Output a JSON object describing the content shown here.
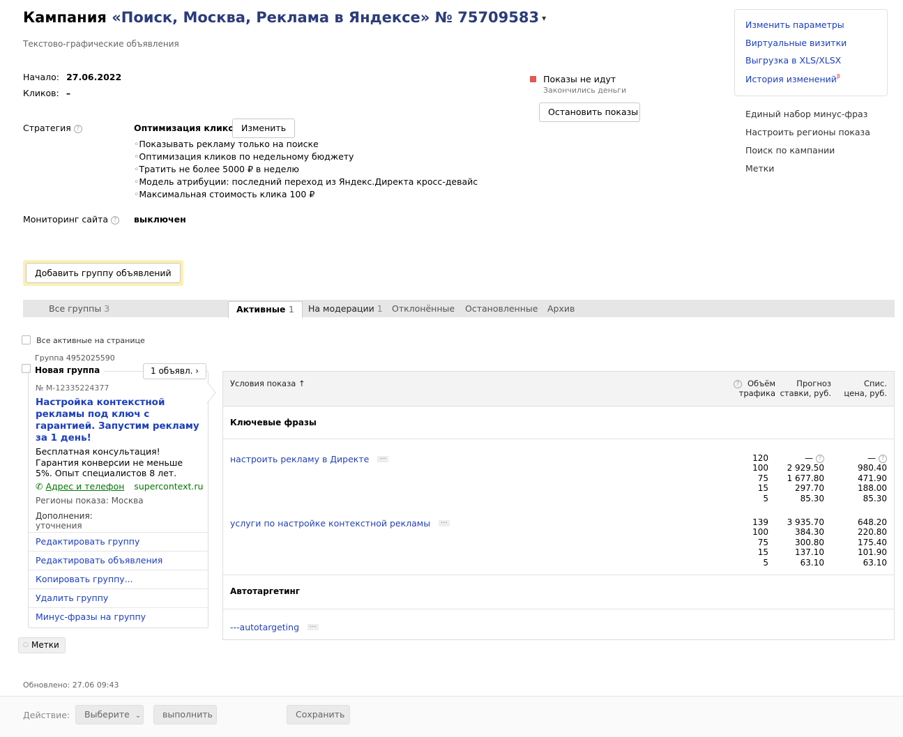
{
  "header": {
    "title_prefix": "Кампания",
    "campaign_name": "«Поиск, Москва, Реклама в Яндексе» № 75709583",
    "subtitle": "Текстово-графические объявления"
  },
  "meta": {
    "start_label": "Начало:",
    "start_value": "27.06.2022",
    "clicks_label": "Кликов:",
    "clicks_value": "–"
  },
  "status": {
    "title": "Показы не идут",
    "reason": "Закончились деньги",
    "stop_button": "Остановить показы",
    "color": "#e55656"
  },
  "strategy": {
    "label": "Стратегия",
    "name": "Оптимизация кликов",
    "change_button": "Изменить",
    "items": [
      "Показывать рекламу только на поиске",
      "Оптимизация кликов по недельному бюджету",
      "Тратить не более 5000 ₽ в неделю",
      "Модель атрибуции: последний переход из Яндекс.Директа кросс-девайс",
      "Максимальная стоимость клика 100 ₽"
    ]
  },
  "monitoring": {
    "label": "Мониторинг сайта",
    "value": "выключен"
  },
  "right_panel": {
    "box_links": [
      "Изменить параметры",
      "Виртуальные визитки",
      "Выгрузка в XLS/XLSX",
      "История изменений"
    ],
    "history_marker": "β",
    "links": [
      "Единый набор минус-фраз",
      "Настроить регионы показа",
      "Поиск по кампании",
      "Метки"
    ]
  },
  "add_group_button": "Добавить группу объявлений",
  "tabs": {
    "all_groups": {
      "label": "Все группы",
      "count": "3"
    },
    "active": {
      "label": "Активные",
      "count": "1"
    },
    "moderation": {
      "label": "На модерации",
      "count": "1"
    },
    "rejected": {
      "label": "Отклонённые"
    },
    "stopped": {
      "label": "Остановленные"
    },
    "archive": {
      "label": "Архив"
    }
  },
  "select_all_label": "Все активные на странице",
  "group": {
    "id_label": "Группа 4952025590",
    "name": "Новая группа",
    "ads_count_button": "1 объявл. ›",
    "ad": {
      "number": "№ М-12335224377",
      "title": "Настройка контекстной рекламы под ключ с гарантией. Запустим рекламу за 1 день!",
      "text": "Бесплатная консультация! Гарантия конверсии не меньше 5%. Опыт специалистов 8 лет.",
      "contact_link": "Адрес и телефон",
      "domain": "supercontext.ru",
      "regions": "Регионы показа: Москва",
      "extras_label": "Дополнения:",
      "extras_value": "уточнения"
    },
    "actions": [
      "Редактировать группу",
      "Редактировать объявления",
      "Копировать группу...",
      "Удалить группу",
      "Минус-фразы на группу"
    ]
  },
  "conditions": {
    "header": {
      "col1": "Условия показа ↑",
      "col2_line1": "Объём",
      "col2_line2": "трафика",
      "col3_line1": "Прогноз",
      "col3_line2": "ставки, руб.",
      "col4_line1": "Спис.",
      "col4_line2": "цена, руб."
    },
    "keywords_section": "Ключевые фразы",
    "keywords": [
      {
        "phrase": "настроить рекламу в Директе",
        "traffic": [
          "120",
          "100",
          "75",
          "15",
          "5"
        ],
        "bids": [
          "—",
          "2 929.50",
          "1 677.80",
          "297.70",
          "85.30"
        ],
        "prices": [
          "—",
          "980.40",
          "471.90",
          "188.00",
          "85.30"
        ]
      },
      {
        "phrase": "услуги по настройке контекстной рекламы",
        "traffic": [
          "139",
          "100",
          "75",
          "15",
          "5"
        ],
        "bids": [
          "3 935.70",
          "384.30",
          "300.80",
          "137.10",
          "63.10"
        ],
        "prices": [
          "648.20",
          "220.80",
          "175.40",
          "101.90",
          "63.10"
        ]
      }
    ],
    "autotargeting_section": "Автотаргетинг",
    "autotargeting_phrase": "---autotargeting",
    "dots": "···"
  },
  "tags_button": "Метки",
  "updated": "Обновлено: 27.06 09:43",
  "footer": {
    "action_label": "Действие:",
    "select_placeholder": "Выберите",
    "execute_button": "выполнить",
    "save_button": "Сохранить"
  }
}
